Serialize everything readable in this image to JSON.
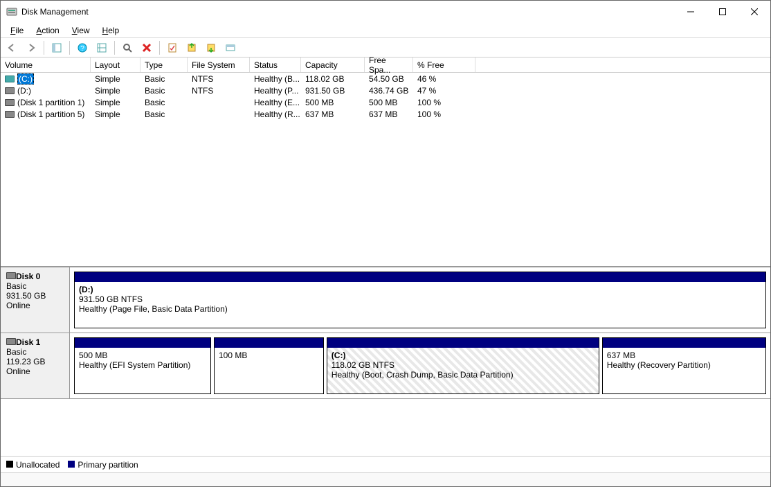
{
  "window": {
    "title": "Disk Management"
  },
  "menu": {
    "file": "File",
    "action": "Action",
    "view": "View",
    "help": "Help"
  },
  "columns": {
    "volume": "Volume",
    "layout": "Layout",
    "type": "Type",
    "fs": "File System",
    "status": "Status",
    "capacity": "Capacity",
    "free": "Free Spa...",
    "pct": "% Free"
  },
  "volumes": [
    {
      "name": "(C:)",
      "layout": "Simple",
      "type": "Basic",
      "fs": "NTFS",
      "status": "Healthy (B...",
      "cap": "118.02 GB",
      "free": "54.50 GB",
      "pct": "46 %",
      "icon": "c",
      "selected": true
    },
    {
      "name": "(D:)",
      "layout": "Simple",
      "type": "Basic",
      "fs": "NTFS",
      "status": "Healthy (P...",
      "cap": "931.50 GB",
      "free": "436.74 GB",
      "pct": "47 %",
      "icon": "d",
      "selected": false
    },
    {
      "name": "(Disk 1 partition 1)",
      "layout": "Simple",
      "type": "Basic",
      "fs": "",
      "status": "Healthy (E...",
      "cap": "500 MB",
      "free": "500 MB",
      "pct": "100 %",
      "icon": "d",
      "selected": false
    },
    {
      "name": "(Disk 1 partition 5)",
      "layout": "Simple",
      "type": "Basic",
      "fs": "",
      "status": "Healthy (R...",
      "cap": "637 MB",
      "free": "637 MB",
      "pct": "100 %",
      "icon": "d",
      "selected": false
    }
  ],
  "disks": [
    {
      "name": "Disk 0",
      "type": "Basic",
      "size": "931.50 GB",
      "state": "Online",
      "partitions": [
        {
          "title": "(D:)",
          "line1": "931.50 GB NTFS",
          "line2": "Healthy (Page File, Basic Data Partition)",
          "flex": 1,
          "primary": true,
          "selected": false
        }
      ]
    },
    {
      "name": "Disk 1",
      "type": "Basic",
      "size": "119.23 GB",
      "state": "Online",
      "partitions": [
        {
          "title": "",
          "line1": "500 MB",
          "line2": "Healthy (EFI System Partition)",
          "flex": 0.2,
          "primary": true,
          "selected": false
        },
        {
          "title": "",
          "line1": "100 MB",
          "line2": "",
          "flex": 0.16,
          "primary": true,
          "selected": false
        },
        {
          "title": "(C:)",
          "line1": "118.02 GB NTFS",
          "line2": "Healthy (Boot, Crash Dump, Basic Data Partition)",
          "flex": 0.4,
          "primary": true,
          "selected": true
        },
        {
          "title": "",
          "line1": "637 MB",
          "line2": "Healthy (Recovery Partition)",
          "flex": 0.24,
          "primary": true,
          "selected": false
        }
      ]
    }
  ],
  "legend": {
    "unalloc": "Unallocated",
    "primary": "Primary partition"
  },
  "colors": {
    "primary": "#000080",
    "unalloc": "#000000",
    "selection": "#0078d7"
  }
}
